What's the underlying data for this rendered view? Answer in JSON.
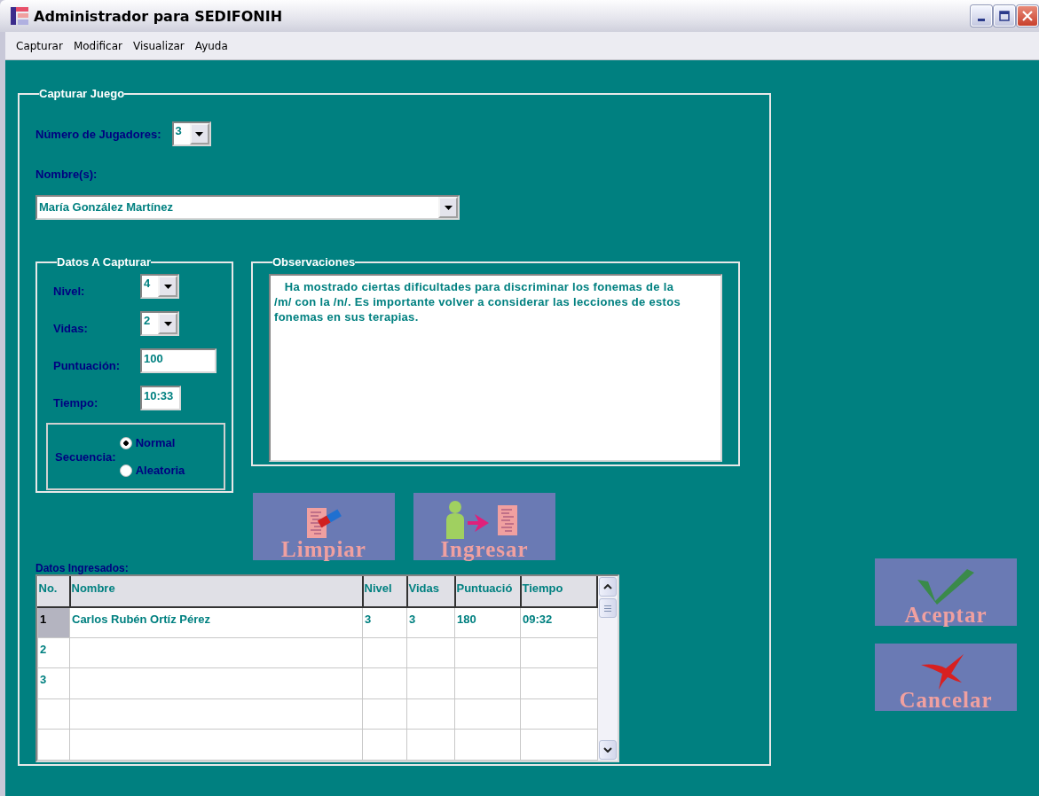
{
  "window": {
    "title": "Administrador para SEDIFONIH"
  },
  "menu": [
    "Capturar",
    "Modificar",
    "Visualizar",
    "Ayuda"
  ],
  "capture_game": {
    "title": "Capturar Juego",
    "players_label": "Número de Jugadores:",
    "players_value": "3",
    "names_label": "Nombre(s):",
    "name_value": "María González Martínez",
    "data": {
      "title": "Datos A Capturar",
      "fields": [
        {
          "kind": "combo",
          "label": "Nivel:",
          "value": "4"
        },
        {
          "kind": "combo",
          "label": "Vidas:",
          "value": "2"
        },
        {
          "kind": "text",
          "label": "Puntuación:",
          "value": "100"
        },
        {
          "kind": "text",
          "label": "Tiempo:",
          "value": "10:33"
        }
      ],
      "sequence": {
        "label": "Secuencia:",
        "options": [
          {
            "label": "Normal",
            "selected": true
          },
          {
            "label": "Aleatoria",
            "selected": false
          }
        ]
      }
    },
    "observations": {
      "title": "Observaciones",
      "text": "   Ha mostrado ciertas dificultades para discriminar los fonemas de la /m/ con la /n/. Es importante volver a considerar las lecciones de estos fonemas en sus terapias."
    },
    "actions": [
      {
        "kind": "clear",
        "label": "Limpiar"
      },
      {
        "kind": "enter",
        "label": "Ingresar"
      }
    ],
    "entered": {
      "label": "Datos Ingresados:",
      "columns": [
        "No.",
        "Nombre",
        "Nivel",
        "Vidas",
        "Puntuació",
        "Tiempo"
      ],
      "rows": [
        {
          "cells": [
            "1",
            "Carlos Rubén Ortíz Pérez",
            "3",
            "3",
            "180",
            "09:32"
          ],
          "selected": true
        },
        {
          "cells": [
            "2"
          ],
          "selected": false
        },
        {
          "cells": [
            "3"
          ],
          "selected": false
        }
      ]
    }
  },
  "dialog_buttons": [
    {
      "kind": "accept",
      "label": "Aceptar"
    },
    {
      "kind": "cancel",
      "label": "Cancelar"
    }
  ]
}
